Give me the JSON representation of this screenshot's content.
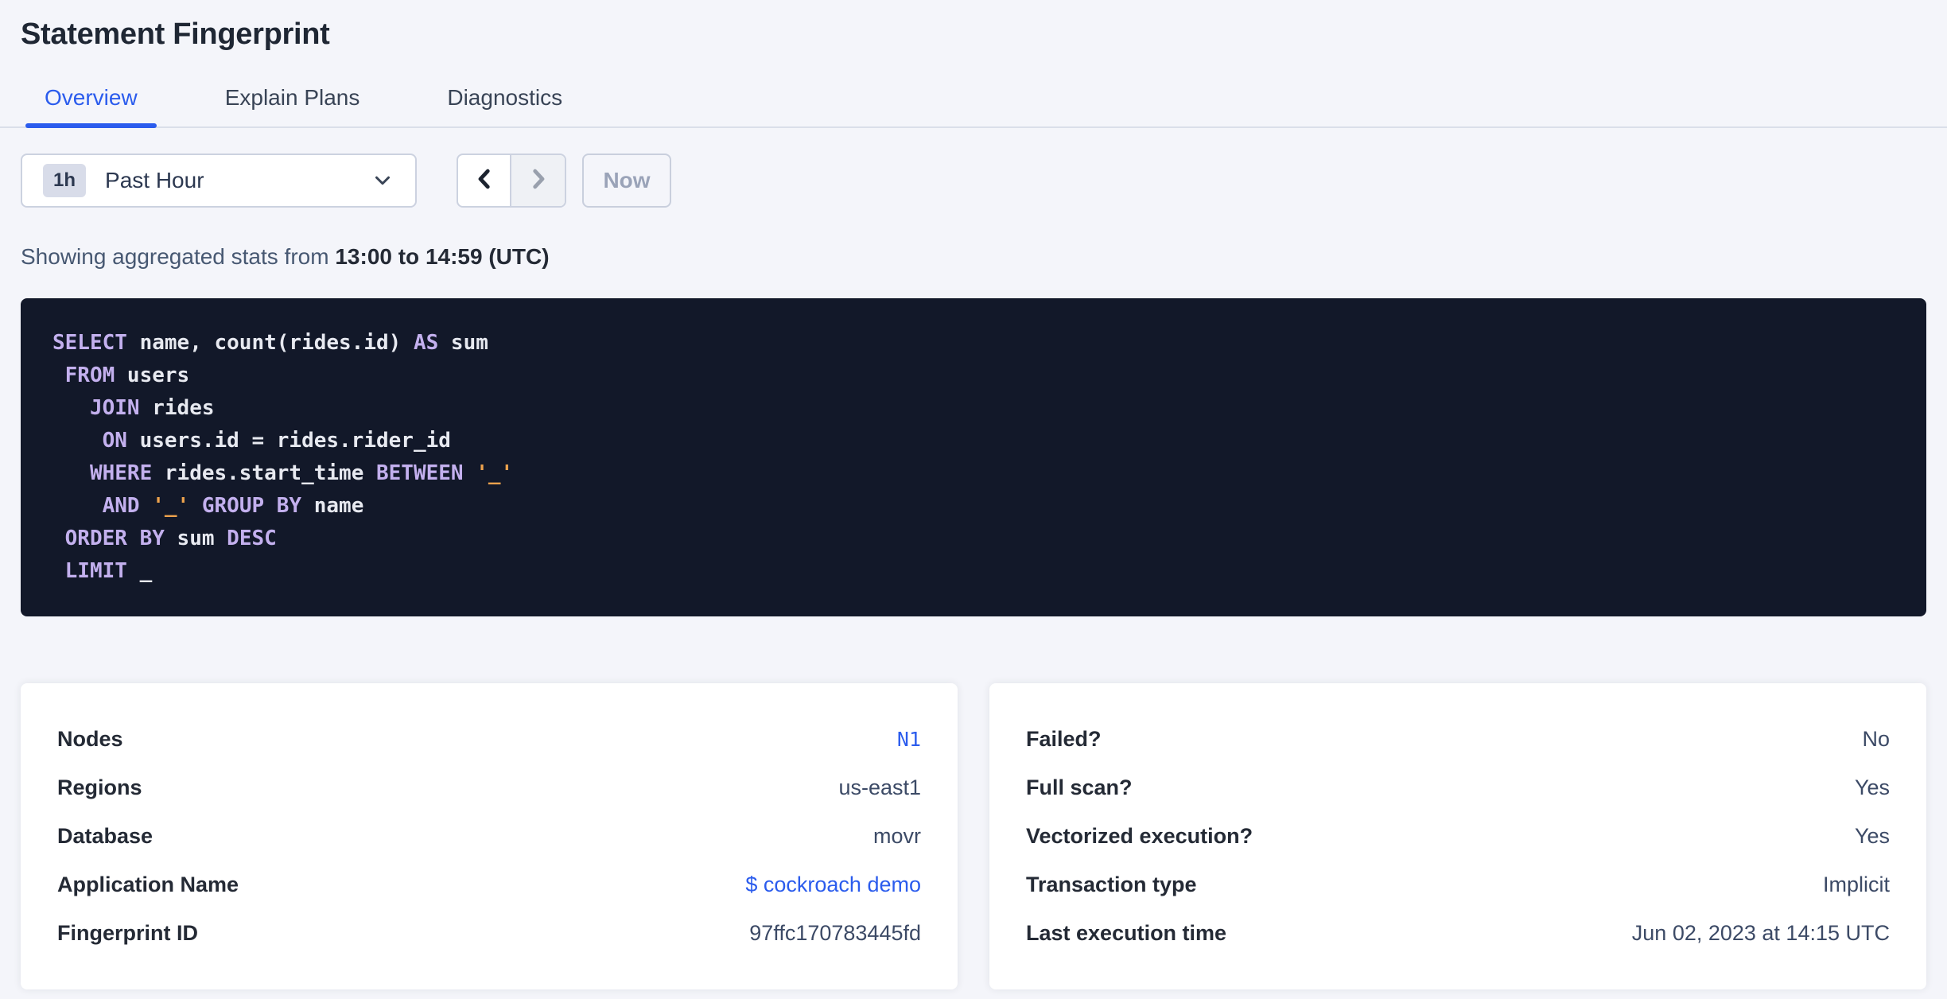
{
  "colors": {
    "accent": "#2b5ced",
    "page-bg": "#f4f5fa",
    "text-dark": "#242a35",
    "text-body": "#475872",
    "text-disabled": "#9aa3b8",
    "border": "#ccd2e0",
    "code-bg": "#121829",
    "code-text": "#e7e9f0",
    "code-keyword": "#c3b0ee",
    "code-string": "#eda24d"
  },
  "page": {
    "title": "Statement Fingerprint"
  },
  "tabs": [
    {
      "label": "Overview",
      "active": true
    },
    {
      "label": "Explain Plans",
      "active": false
    },
    {
      "label": "Diagnostics",
      "active": false
    }
  ],
  "time_picker": {
    "badge": "1h",
    "selected": "Past Hour",
    "prev_enabled": true,
    "next_enabled": false,
    "now_label": "Now"
  },
  "stats_line": {
    "prefix": "Showing aggregated stats from ",
    "range": "13:00 to 14:59 (UTC)"
  },
  "sql": {
    "lines": [
      [
        {
          "t": "kw",
          "v": "SELECT"
        },
        {
          "t": "id",
          "v": " name, count(rides.id) "
        },
        {
          "t": "kw",
          "v": "AS"
        },
        {
          "t": "id",
          "v": " sum"
        }
      ],
      [
        {
          "t": "kw",
          "v": " FROM"
        },
        {
          "t": "id",
          "v": " users"
        }
      ],
      [
        {
          "t": "kw",
          "v": "   JOIN"
        },
        {
          "t": "id",
          "v": " rides"
        }
      ],
      [
        {
          "t": "kw",
          "v": "    ON"
        },
        {
          "t": "id",
          "v": " users.id = rides.rider_id"
        }
      ],
      [
        {
          "t": "kw",
          "v": "   WHERE"
        },
        {
          "t": "id",
          "v": " rides.start_time "
        },
        {
          "t": "kw",
          "v": "BETWEEN"
        },
        {
          "t": "id",
          "v": " "
        },
        {
          "t": "str",
          "v": "'_'"
        }
      ],
      [
        {
          "t": "kw",
          "v": "    AND"
        },
        {
          "t": "id",
          "v": " "
        },
        {
          "t": "str",
          "v": "'_'"
        },
        {
          "t": "id",
          "v": " "
        },
        {
          "t": "kw",
          "v": "GROUP BY"
        },
        {
          "t": "id",
          "v": " name"
        }
      ],
      [
        {
          "t": "kw",
          "v": " ORDER BY"
        },
        {
          "t": "id",
          "v": " sum "
        },
        {
          "t": "kw",
          "v": "DESC"
        }
      ],
      [
        {
          "t": "kw",
          "v": " LIMIT"
        },
        {
          "t": "id",
          "v": " _"
        }
      ]
    ]
  },
  "cards": {
    "left": {
      "rows": [
        {
          "label": "Nodes",
          "value": "N1",
          "link": true,
          "mono": true
        },
        {
          "label": "Regions",
          "value": "us-east1"
        },
        {
          "label": "Database",
          "value": "movr"
        },
        {
          "label": "Application Name",
          "value": "$ cockroach demo",
          "link": true
        },
        {
          "label": "Fingerprint ID",
          "value": "97ffc170783445fd"
        }
      ]
    },
    "right": {
      "rows": [
        {
          "label": "Failed?",
          "value": "No"
        },
        {
          "label": "Full scan?",
          "value": "Yes"
        },
        {
          "label": "Vectorized execution?",
          "value": "Yes"
        },
        {
          "label": "Transaction type",
          "value": "Implicit"
        },
        {
          "label": "Last execution time",
          "value": "Jun 02, 2023 at 14:15 UTC"
        }
      ]
    }
  }
}
